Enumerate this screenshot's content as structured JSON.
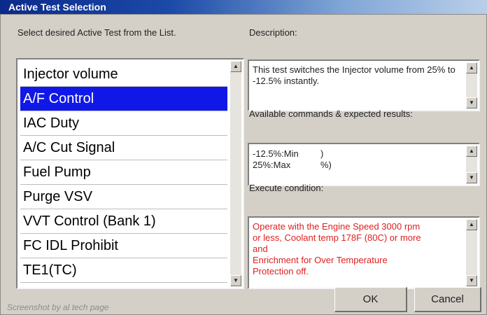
{
  "window": {
    "title": "Active Test Selection"
  },
  "list": {
    "label": "Select desired Active Test from the List.",
    "items": [
      "Injector volume",
      "A/F Control",
      "IAC Duty",
      "A/C Cut Signal",
      "Fuel Pump",
      "Purge VSV",
      "VVT Control (Bank 1)",
      "FC IDL Prohibit",
      "TE1(TC)"
    ],
    "selected_index": 1
  },
  "description": {
    "label": "Description:",
    "text": "This test switches the Injector volume from 25% to -12.5% instantly."
  },
  "commands": {
    "label": "Available commands & expected results:",
    "col1": [
      "-12.5%:Min",
      "25%:Max"
    ],
    "col2": [
      ")",
      "%)"
    ]
  },
  "condition": {
    "label": "Execute condition:",
    "lines": [
      "Operate with the Engine Speed 3000 rpm",
      "or less, Coolant temp 178F (80C) or more",
      "and",
      "Enrichment for Over Temperature",
      "Protection off."
    ]
  },
  "buttons": {
    "ok": "OK",
    "cancel": "Cancel"
  },
  "watermark": "Screenshot by al tech page",
  "colors": {
    "selection": "#1018e8",
    "condition_text": "#e02020"
  }
}
